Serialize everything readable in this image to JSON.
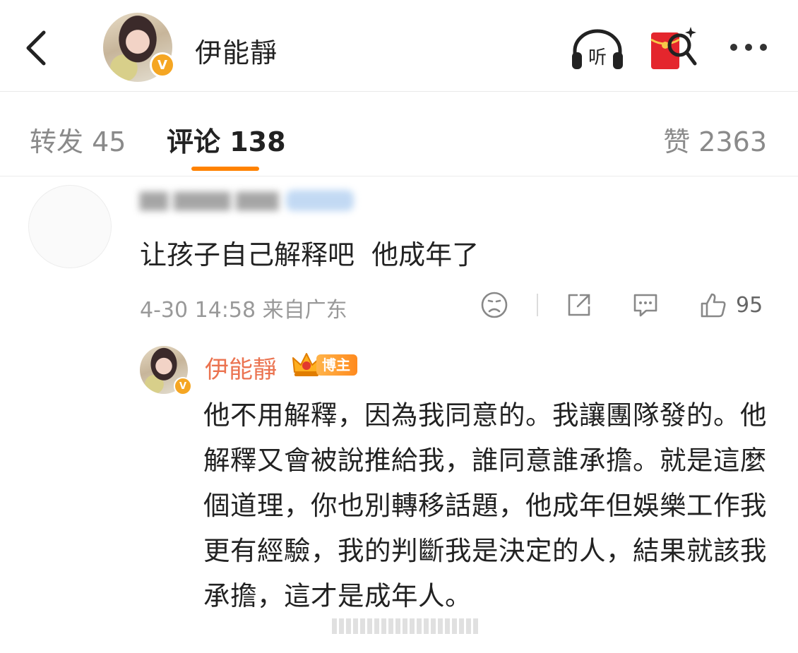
{
  "header": {
    "name": "伊能靜",
    "verified_badge": "V",
    "listen_label": "听",
    "icons": [
      "back-arrow-icon",
      "avatar",
      "headphones-icon",
      "red-packet-search-icon",
      "more-icon"
    ]
  },
  "tabs": {
    "repost": "转发 45",
    "comments": "评论 138",
    "likes": "赞 2363"
  },
  "comment": {
    "text": "让孩子自己解释吧  他成年了",
    "meta": "4-30 14:58 来自广东",
    "like_count": "95"
  },
  "reply": {
    "name": "伊能靜",
    "badge": "博主",
    "text": "他不用解釋，因為我同意的。我讓團隊發的。他解釋又會被說推給我，誰同意誰承擔。就是這麼個道理，你也別轉移話題，他成年但娛樂工作我更有經驗，我的判斷我是決定的人，結果就該我承擔，這才是成年人。"
  },
  "colors": {
    "accent_orange": "#ff8200",
    "reply_name": "#eb7350",
    "verified": "#f5a623",
    "red_packet": "#e4262d"
  }
}
